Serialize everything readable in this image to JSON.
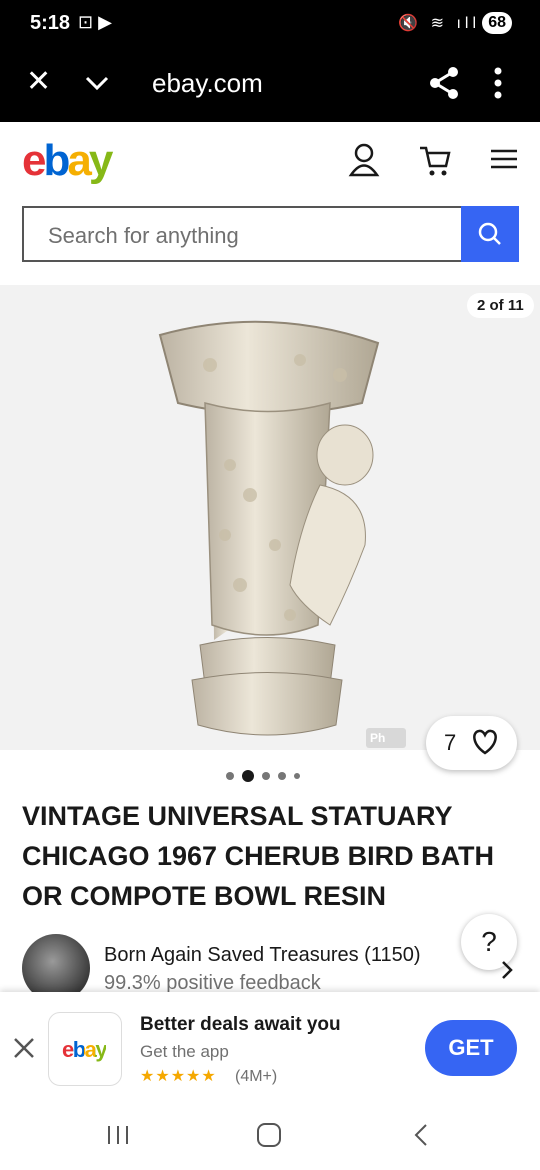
{
  "status_bar": {
    "time": "5:18",
    "battery": "68"
  },
  "browser": {
    "url": "ebay.com"
  },
  "header": {
    "logo": [
      "e",
      "b",
      "a",
      "y"
    ]
  },
  "search": {
    "placeholder": "Search for anything"
  },
  "gallery": {
    "counter": "2 of 11",
    "watermark": "Ph",
    "watch_count": "7",
    "dot_count": 5,
    "active_dot": 1
  },
  "listing": {
    "title": "VINTAGE UNIVERSAL STATUARY CHICAGO 1967 CHERUB BIRD BATH OR COMPOTE BOWL RESIN"
  },
  "seller": {
    "name": "Born Again Saved Treasures (1150)",
    "feedback": "99.3% positive feedback"
  },
  "help": {
    "label": "?"
  },
  "banner": {
    "title": "Better deals await you",
    "subtitle": "Get the app",
    "stars": "★★★★★",
    "rating": "(4M+)",
    "button": "GET",
    "app_logo": "ebay"
  },
  "colors": {
    "accent": "#3665f3",
    "logo_red": "#e53238",
    "logo_blue": "#0064d2",
    "logo_yellow": "#f5af02",
    "logo_green": "#86b817"
  }
}
